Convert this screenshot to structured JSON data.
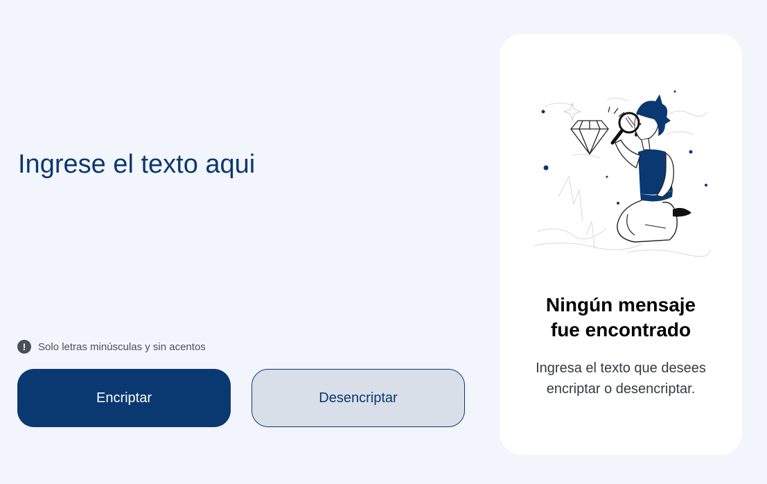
{
  "input": {
    "placeholder": "Ingrese el texto aqui",
    "value": ""
  },
  "hint": {
    "icon": "exclamation-circle-icon",
    "text": "Solo letras minúsculas y sin acentos"
  },
  "buttons": {
    "encrypt_label": "Encriptar",
    "decrypt_label": "Desencriptar"
  },
  "output_panel": {
    "illustration": "person-with-magnifying-glass-illustration",
    "title_line1": "Ningún mensaje",
    "title_line2": "fue encontrado",
    "text_line1": "Ingresa el texto que desees",
    "text_line2": "encriptar o desencriptar."
  },
  "colors": {
    "background": "#F3F5FC",
    "primary": "#0A3871",
    "secondary_button": "#D8DFE8",
    "panel": "#FFFFFF",
    "hint": "#495057"
  }
}
